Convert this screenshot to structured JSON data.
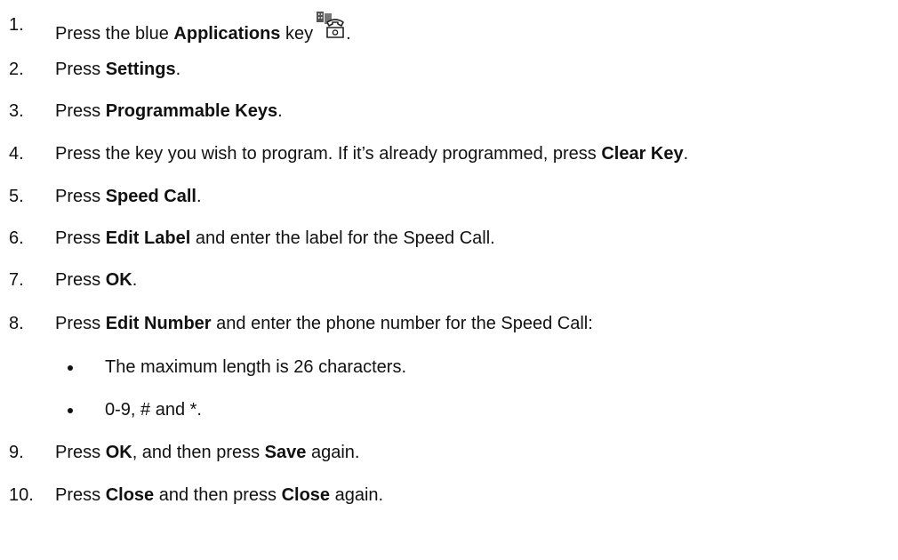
{
  "steps": [
    {
      "number": "1.",
      "parts": [
        "Press the blue ",
        "Applications",
        " key",
        "."
      ],
      "icon": "applications-key-phone-icon"
    },
    {
      "number": "2.",
      "parts": [
        "Press ",
        "Settings",
        "."
      ]
    },
    {
      "number": "3.",
      "parts": [
        "Press ",
        "Programmable Keys",
        "."
      ]
    },
    {
      "number": "4.",
      "parts": [
        "Press the key you wish to program. If it’s already programmed, press ",
        "Clear Key",
        "."
      ]
    },
    {
      "number": "5.",
      "parts": [
        "Press ",
        "Speed Call",
        "."
      ]
    },
    {
      "number": "6.",
      "parts": [
        "Press ",
        "Edit Label",
        " and enter the label for the Speed Call."
      ]
    },
    {
      "number": "7.",
      "parts": [
        "Press ",
        "OK",
        "."
      ]
    },
    {
      "number": "8.",
      "parts": [
        "Press ",
        "Edit Number",
        " and enter the phone number for the Speed Call:"
      ]
    },
    {
      "number": "9.",
      "parts": [
        "Press ",
        "OK",
        ", and then press ",
        "Save",
        " again."
      ]
    },
    {
      "number": "10.",
      "parts": [
        "Press ",
        "Close",
        " and then press ",
        "Close",
        " again."
      ]
    }
  ],
  "step8_bullets": [
    "The maximum length is 26 characters.",
    "0-9, # and *."
  ]
}
